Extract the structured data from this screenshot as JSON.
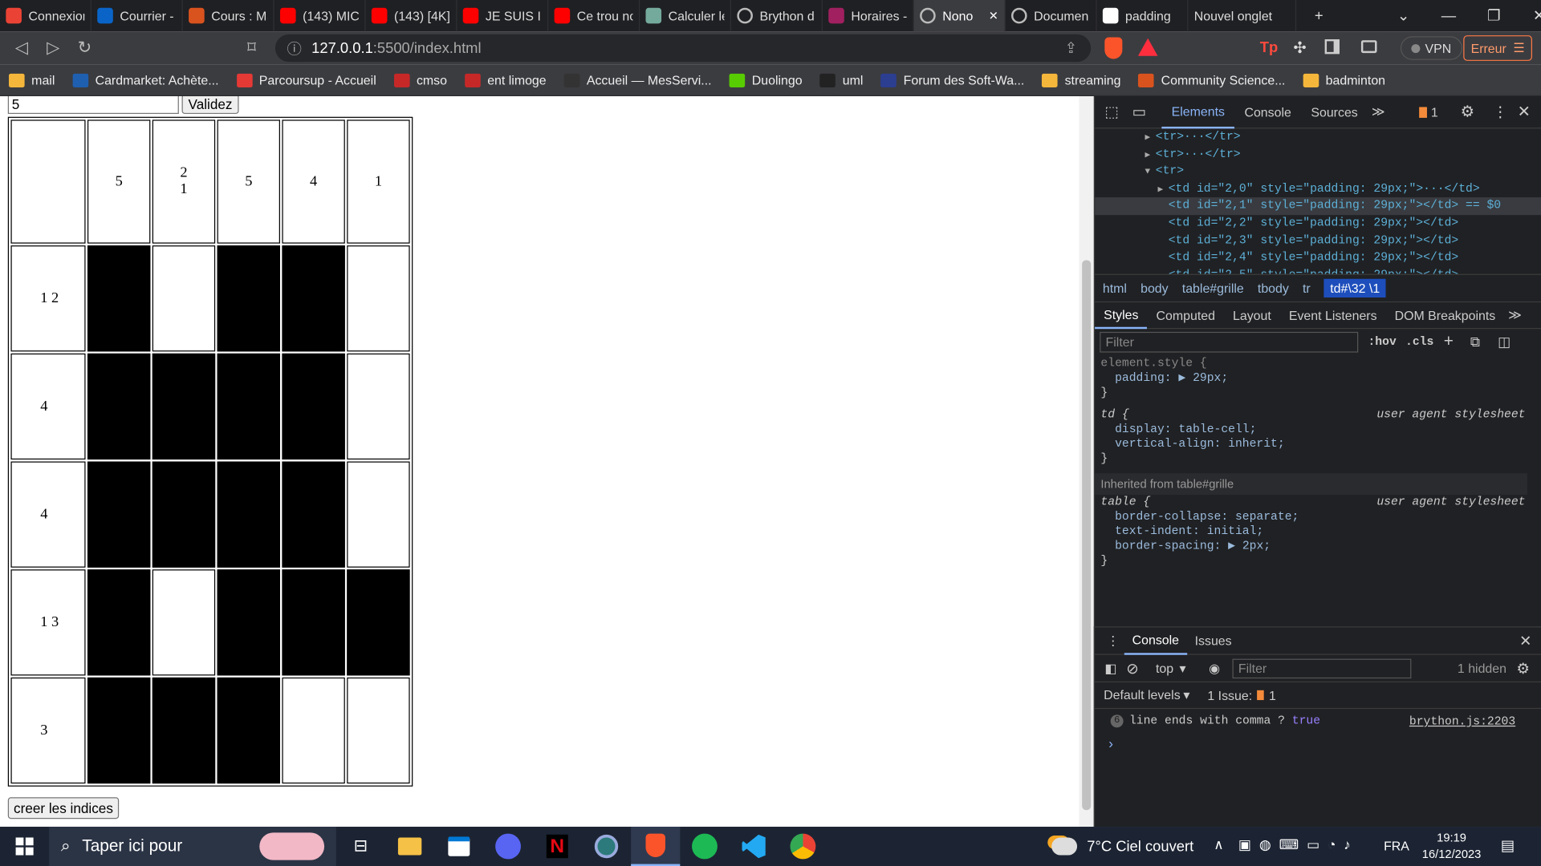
{
  "tabs": [
    {
      "label": "Connexion",
      "icon": "gmail-icon",
      "color": "#ea4335"
    },
    {
      "label": "Courrier -",
      "icon": "outlook-icon",
      "color": "#0a64c8"
    },
    {
      "label": "Cours : Ma",
      "icon": "moodle-icon",
      "color": "#d9531e"
    },
    {
      "label": "(143) MICI",
      "icon": "youtube-icon",
      "color": "#ff0000"
    },
    {
      "label": "(143) [4K]",
      "icon": "youtube-icon",
      "color": "#ff0000"
    },
    {
      "label": "JE SUIS IR",
      "icon": "youtube-icon",
      "color": "#ff0000"
    },
    {
      "label": "Ce trou no",
      "icon": "youtube-icon",
      "color": "#ff0000"
    },
    {
      "label": "Calculer le",
      "icon": "chatgpt-icon",
      "color": "#74aa9c"
    },
    {
      "label": "Brython d",
      "icon": "globe-icon",
      "color": "#888888"
    },
    {
      "label": "Horaires -",
      "icon": "sncf-icon",
      "color": "#a02060"
    },
    {
      "label": "Nono",
      "icon": "globe-icon",
      "color": "#888888"
    },
    {
      "label": "Documen",
      "icon": "globe-icon",
      "color": "#888888"
    },
    {
      "label": "padding",
      "icon": "mdn-icon",
      "color": "#ffffff"
    },
    {
      "label": "Nouvel onglet",
      "icon": "",
      "color": ""
    }
  ],
  "address": {
    "host": "127.0.0.1",
    "path": ":5500/index.html"
  },
  "vpn_label": "VPN",
  "error_label": "Erreur",
  "bookmarks": [
    {
      "label": "mail",
      "color": "#f5b73b"
    },
    {
      "label": "Cardmarket: Achète...",
      "color": "#1f5fb0"
    },
    {
      "label": "Parcoursup - Accueil",
      "color": "#e53935"
    },
    {
      "label": "cmso",
      "color": "#c62828"
    },
    {
      "label": "ent limoge",
      "color": "#c62828"
    },
    {
      "label": "Accueil — MesServi...",
      "color": "#333333"
    },
    {
      "label": "Duolingo",
      "color": "#58cc02"
    },
    {
      "label": "uml",
      "color": "#222222"
    },
    {
      "label": "Forum des Soft-Wa...",
      "color": "#2c3e90"
    },
    {
      "label": "streaming",
      "color": "#f5b73b"
    },
    {
      "label": "Community Science...",
      "color": "#d9531e"
    },
    {
      "label": "badminton",
      "color": "#f5b73b"
    }
  ],
  "page": {
    "input_value": "5",
    "validate_label": "Validez",
    "create_label": "creer les indices",
    "col_clues": [
      [
        "5"
      ],
      [
        "2",
        "1"
      ],
      [
        "5"
      ],
      [
        "4"
      ],
      [
        "1"
      ]
    ],
    "rows": [
      {
        "clue": "1 2",
        "cells": [
          1,
          0,
          1,
          1,
          0
        ]
      },
      {
        "clue": "4",
        "cells": [
          1,
          1,
          1,
          1,
          0
        ]
      },
      {
        "clue": "4",
        "cells": [
          1,
          1,
          1,
          1,
          0
        ]
      },
      {
        "clue": "1 3",
        "cells": [
          1,
          0,
          1,
          1,
          1
        ]
      },
      {
        "clue": "3",
        "cells": [
          1,
          1,
          1,
          0,
          0
        ]
      }
    ]
  },
  "devtools": {
    "tabs": [
      "Elements",
      "Console",
      "Sources"
    ],
    "issues_count": "1",
    "dom_lines": [
      {
        "indent": 3,
        "arrow": "▶",
        "text": "<tr>···</tr>"
      },
      {
        "indent": 3,
        "arrow": "▶",
        "text": "<tr>···</tr>"
      },
      {
        "indent": 3,
        "arrow": "▼",
        "text": "<tr>"
      },
      {
        "indent": 4,
        "arrow": "▶",
        "text": "<td id=\"2,0\" style=\"padding: 29px;\">···</td>"
      },
      {
        "indent": 4,
        "arrow": "",
        "text": "<td id=\"2,1\" style=\"padding: 29px;\"></td> == $0"
      },
      {
        "indent": 4,
        "arrow": "",
        "text": "<td id=\"2,2\" style=\"padding: 29px;\"></td>"
      },
      {
        "indent": 4,
        "arrow": "",
        "text": "<td id=\"2,3\" style=\"padding: 29px;\"></td>"
      },
      {
        "indent": 4,
        "arrow": "",
        "text": "<td id=\"2,4\" style=\"padding: 29px;\"></td>"
      },
      {
        "indent": 4,
        "arrow": "",
        "text": "<td id=\"2,5\" style=\"padding: 29px;\"></td>"
      }
    ],
    "breadcrumbs": [
      "html",
      "body",
      "table#grille",
      "tbody",
      "tr",
      "td#\\32 \\1"
    ],
    "style_tabs": [
      "Styles",
      "Computed",
      "Layout",
      "Event Listeners",
      "DOM Breakpoints"
    ],
    "filter_placeholder": "Filter",
    "hov_label": ":hov",
    "cls_label": ".cls",
    "styles": [
      {
        "t": "element.style {",
        "cls": "dim"
      },
      {
        "t": "  padding: ▶ 29px;",
        "cls": "prop"
      },
      {
        "t": "}",
        "cls": ""
      },
      {
        "t": "td {                                   user agent stylesheet",
        "cls": "ital"
      },
      {
        "t": "  display: table-cell;",
        "cls": "prop"
      },
      {
        "t": "  vertical-align: inherit;",
        "cls": "prop"
      },
      {
        "t": "}",
        "cls": ""
      },
      {
        "t": "Inherited from table#grille",
        "cls": "inh"
      },
      {
        "t": "table {                                user agent stylesheet",
        "cls": "ital"
      },
      {
        "t": "  border-collapse: separate;",
        "cls": "prop"
      },
      {
        "t": "  text-indent: initial;",
        "cls": "prop"
      },
      {
        "t": "  border-spacing: ▶ 2px;",
        "cls": "prop"
      },
      {
        "t": "}",
        "cls": ""
      }
    ],
    "console": {
      "tabs": [
        "Console",
        "Issues"
      ],
      "context": "top",
      "filter_placeholder": "Filter",
      "hidden": "1 hidden",
      "levels": "Default levels",
      "issue": "1 Issue:",
      "issue_count": "1",
      "log_count": "6",
      "log_text": "line ends with comma ? ",
      "log_value": "true",
      "log_source": "brython.js:2203",
      "prompt": "›"
    }
  },
  "taskbar": {
    "search": "Taper ici pour",
    "weather": "7°C  Ciel couvert",
    "lang": "FRA",
    "time": "19:19",
    "date": "16/12/2023"
  }
}
